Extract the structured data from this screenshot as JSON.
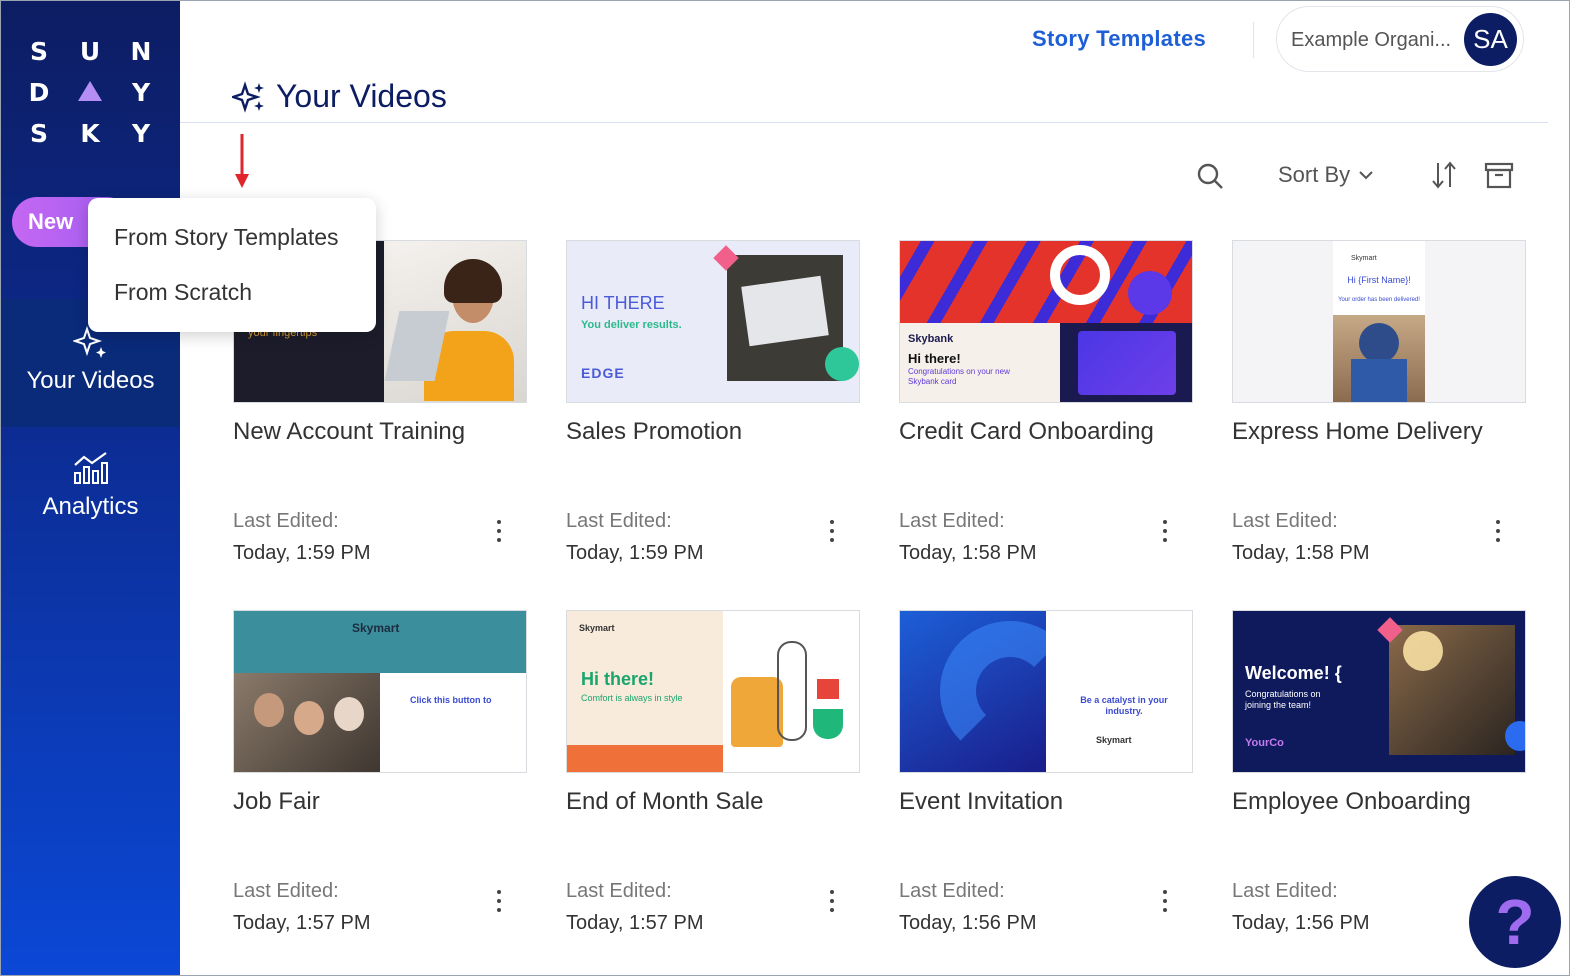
{
  "brand": {
    "logo_rows": [
      [
        "S",
        "U",
        "N"
      ],
      [
        "D",
        "",
        "Y"
      ],
      [
        "S",
        "K",
        "Y"
      ]
    ]
  },
  "sidebar": {
    "new_label": "New",
    "items": [
      {
        "label": "Your Videos",
        "icon": "sparkle-icon",
        "active": true
      },
      {
        "label": "Analytics",
        "icon": "analytics-icon",
        "active": false
      }
    ]
  },
  "header": {
    "story_templates_label": "Story Templates",
    "org_name": "Example Organi...",
    "avatar_initials": "SA"
  },
  "page": {
    "title": "Your Videos"
  },
  "toolbar": {
    "sort_label": "Sort By"
  },
  "new_menu": {
    "items": [
      "From Story Templates",
      "From Scratch"
    ]
  },
  "videos": [
    {
      "title": "New Account Training",
      "last_edited_label": "Last Edited:",
      "date": "Today, 1:59 PM",
      "thumb_text": [
        "your fingertips"
      ]
    },
    {
      "title": "Sales Promotion",
      "last_edited_label": "Last Edited:",
      "date": "Today, 1:59 PM",
      "thumb_text": [
        "HI THERE",
        "You deliver results.",
        "EDGE"
      ]
    },
    {
      "title": "Credit Card Onboarding",
      "last_edited_label": "Last Edited:",
      "date": "Today, 1:58 PM",
      "thumb_text": [
        "Skybank",
        "Hi there!",
        "Congratulations on your new Skybank card"
      ]
    },
    {
      "title": "Express Home Delivery",
      "last_edited_label": "Last Edited:",
      "date": "Today, 1:58 PM",
      "thumb_text": [
        "Skymart",
        "Hi {First Name}!",
        "Your order has been delivered!"
      ]
    },
    {
      "title": "Job Fair",
      "last_edited_label": "Last Edited:",
      "date": "Today, 1:57 PM",
      "thumb_text": [
        "Skymart",
        "Click this button to"
      ]
    },
    {
      "title": "End of Month Sale",
      "last_edited_label": "Last Edited:",
      "date": "Today, 1:57 PM",
      "thumb_text": [
        "Skymart",
        "Hi there!",
        "Comfort is always in style"
      ]
    },
    {
      "title": "Event Invitation",
      "last_edited_label": "Last Edited:",
      "date": "Today, 1:56 PM",
      "thumb_text": [
        "Be a catalyst in your industry.",
        "Skymart"
      ]
    },
    {
      "title": "Employee Onboarding",
      "last_edited_label": "Last Edited:",
      "date": "Today, 1:56 PM",
      "thumb_text": [
        "Welcome! {",
        "Congratulations on joining the team!",
        "YourCo"
      ]
    }
  ],
  "help": {
    "label": "?"
  },
  "colors": {
    "sidebar_top": "#0d1d63",
    "sidebar_bottom": "#0b48d6",
    "accent": "#1f5fd6",
    "new_button": "#c468f2"
  }
}
